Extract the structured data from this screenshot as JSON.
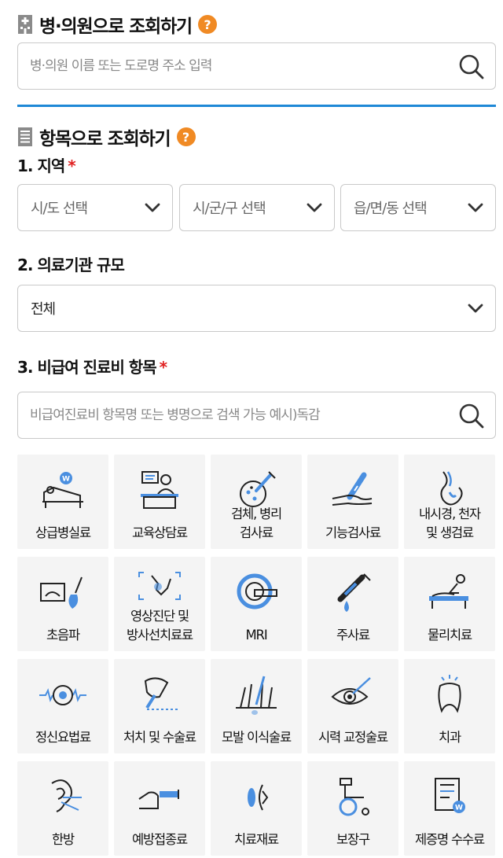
{
  "hospital_search": {
    "title": "병·의원으로 조회하기",
    "help": "?",
    "placeholder": "병·의원 이름 또는 도로명 주소 입력",
    "value": ""
  },
  "item_search": {
    "title": "항목으로 조회하기",
    "help": "?"
  },
  "region": {
    "label": "1. 지역",
    "required_mark": "*",
    "selects": [
      {
        "value": "시/도 선택"
      },
      {
        "value": "시/군/구 선택"
      },
      {
        "value": "읍/면/동 선택"
      }
    ]
  },
  "scale": {
    "label": "2. 의료기관 규모",
    "value": "전체"
  },
  "items": {
    "label": "3. 비급여 진료비 항목",
    "required_mark": "*",
    "placeholder": "비급여진료비 항목명 또는 병명으로 검색 가능 예시)독감",
    "value": ""
  },
  "colors": {
    "accent_blue": "#1e88d6",
    "help_orange": "#f08a24",
    "required_red": "#e02020",
    "tile_bg": "#f4f4f4"
  },
  "categories": [
    {
      "label": "상급병실료",
      "icon": "hospital-bed-icon"
    },
    {
      "label": "교육상담료",
      "icon": "counseling-desk-icon"
    },
    {
      "label": "검체, 병리\n검사료",
      "icon": "specimen-dish-icon"
    },
    {
      "label": "기능검사료",
      "icon": "thermometer-arm-icon"
    },
    {
      "label": "내시경, 천자\n및 생검료",
      "icon": "endoscope-stomach-icon"
    },
    {
      "label": "초음파",
      "icon": "ultrasound-icon"
    },
    {
      "label": "영상진단 및\n방사선치료료",
      "icon": "xray-joint-icon"
    },
    {
      "label": "MRI",
      "icon": "mri-scanner-icon"
    },
    {
      "label": "주사료",
      "icon": "syringe-icon"
    },
    {
      "label": "물리치료",
      "icon": "physical-therapy-icon"
    },
    {
      "label": "정신요법료",
      "icon": "brain-wave-icon"
    },
    {
      "label": "처치 및 수술료",
      "icon": "scalpel-hand-icon"
    },
    {
      "label": "모발 이식술료",
      "icon": "hair-transplant-icon"
    },
    {
      "label": "시력 교정술료",
      "icon": "eye-laser-icon"
    },
    {
      "label": "치과",
      "icon": "tooth-icon"
    },
    {
      "label": "한방",
      "icon": "ear-acupuncture-icon"
    },
    {
      "label": "예방접종료",
      "icon": "vaccine-arm-icon"
    },
    {
      "label": "치료재료",
      "icon": "lens-material-icon"
    },
    {
      "label": "보장구",
      "icon": "wheelchair-icon"
    },
    {
      "label": "제증명 수수료",
      "icon": "certificate-icon"
    }
  ]
}
